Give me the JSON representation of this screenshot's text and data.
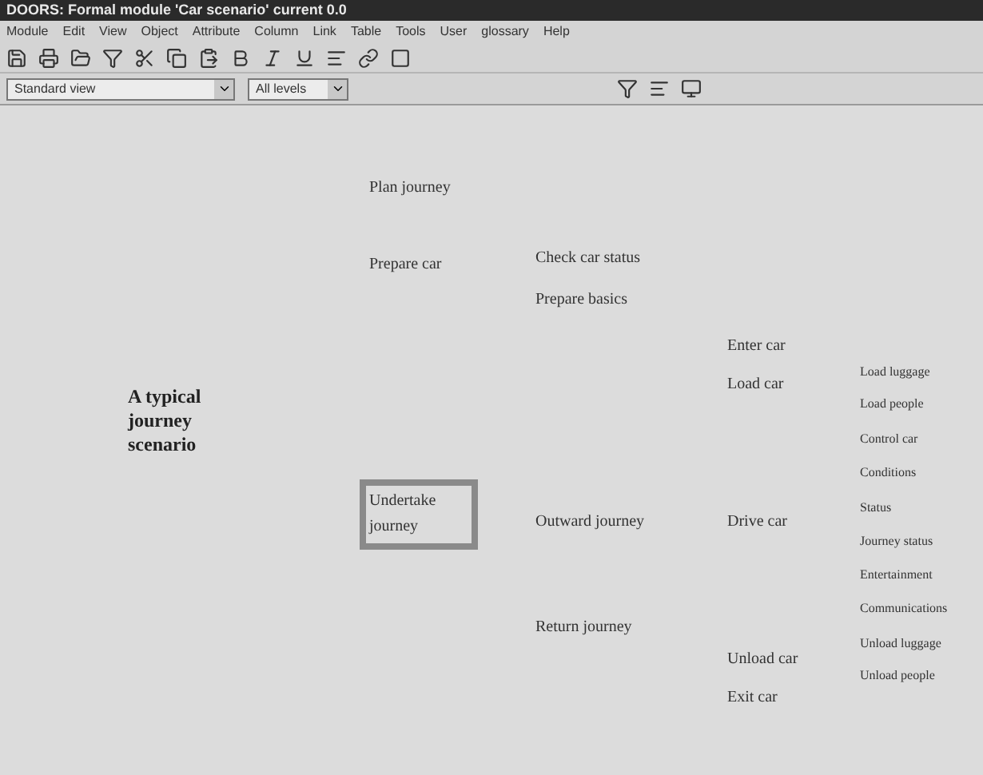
{
  "window": {
    "title": "DOORS: Formal module 'Car scenario' current 0.0"
  },
  "menu": [
    "Module",
    "Edit",
    "View",
    "Object",
    "Attribute",
    "Column",
    "Link",
    "Table",
    "Tools",
    "User",
    "glossary",
    "Help"
  ],
  "toolbar": {
    "view": "Standard view",
    "levels": "All levels"
  },
  "canvas": {
    "heading": "A typical journey scenario",
    "nodes": [
      {
        "text": "Plan journey",
        "selected": false
      },
      {
        "text": "Prepare car",
        "selected": false
      },
      {
        "text": "Check car status",
        "selected": false
      },
      {
        "text": "Prepare basics",
        "selected": false
      },
      {
        "text": "Enter car",
        "selected": false
      },
      {
        "text": "Load car",
        "selected": false
      },
      {
        "text": "Load luggage",
        "selected": false
      },
      {
        "text": "Load people",
        "selected": false
      },
      {
        "text": "Control car",
        "selected": false
      },
      {
        "text": "Conditions",
        "selected": false
      },
      {
        "text": "Status",
        "selected": false
      },
      {
        "text": "Journey status",
        "selected": false
      },
      {
        "text": "Entertainment",
        "selected": false
      },
      {
        "text": "Communications",
        "selected": false
      },
      {
        "text": "Undertake journey",
        "selected": true
      },
      {
        "text": "Outward journey",
        "selected": false
      },
      {
        "text": "Drive car",
        "selected": false
      },
      {
        "text": "Return journey",
        "selected": false
      },
      {
        "text": "Unload car",
        "selected": false
      },
      {
        "text": "Unload luggage",
        "selected": false
      },
      {
        "text": "Unload people",
        "selected": false
      },
      {
        "text": "Exit car",
        "selected": false
      }
    ]
  }
}
